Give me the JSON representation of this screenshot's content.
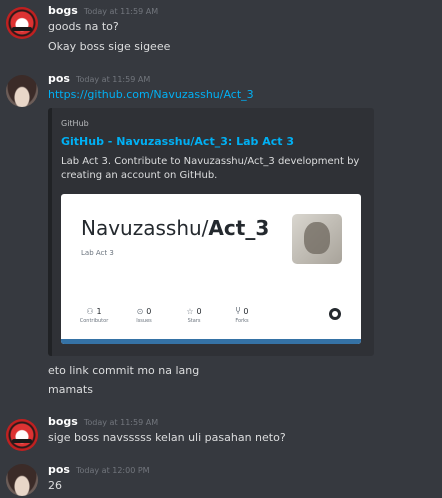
{
  "messages": [
    {
      "author": "bogs",
      "timestamp": "Today at 11:59 AM",
      "lines": [
        "goods na to?",
        "Okay boss sige sigeee"
      ]
    },
    {
      "author": "pos",
      "timestamp": "Today at 11:59 AM",
      "link": "https://github.com/Navuzasshu/Act_3",
      "embed": {
        "provider": "GitHub",
        "title": "GitHub - Navuzasshu/Act_3: Lab Act 3",
        "description": "Lab Act 3. Contribute to Navuzasshu/Act_3 development by creating an account on GitHub.",
        "card": {
          "owner": "Navuzasshu/",
          "repo": "Act_3",
          "subtitle": "Lab Act 3",
          "stats": [
            {
              "icon": "contributors-icon",
              "value": "1",
              "label": "Contributor"
            },
            {
              "icon": "issues-icon",
              "value": "0",
              "label": "Issues"
            },
            {
              "icon": "star-icon",
              "value": "0",
              "label": "Stars"
            },
            {
              "icon": "fork-icon",
              "value": "0",
              "label": "Forks"
            }
          ],
          "bar_color": "#3572a5"
        }
      },
      "after_lines": [
        "eto link commit mo na lang",
        "mamats"
      ]
    },
    {
      "author": "bogs",
      "timestamp": "Today at 11:59 AM",
      "lines": [
        "sige boss navsssss kelan uli pasahan neto?"
      ]
    },
    {
      "author": "pos",
      "timestamp": "Today at 12:00 PM",
      "lines": [
        "26"
      ]
    }
  ],
  "colors": {
    "background": "#36393f",
    "link": "#00b0f4",
    "embed_bg": "#2f3136"
  }
}
